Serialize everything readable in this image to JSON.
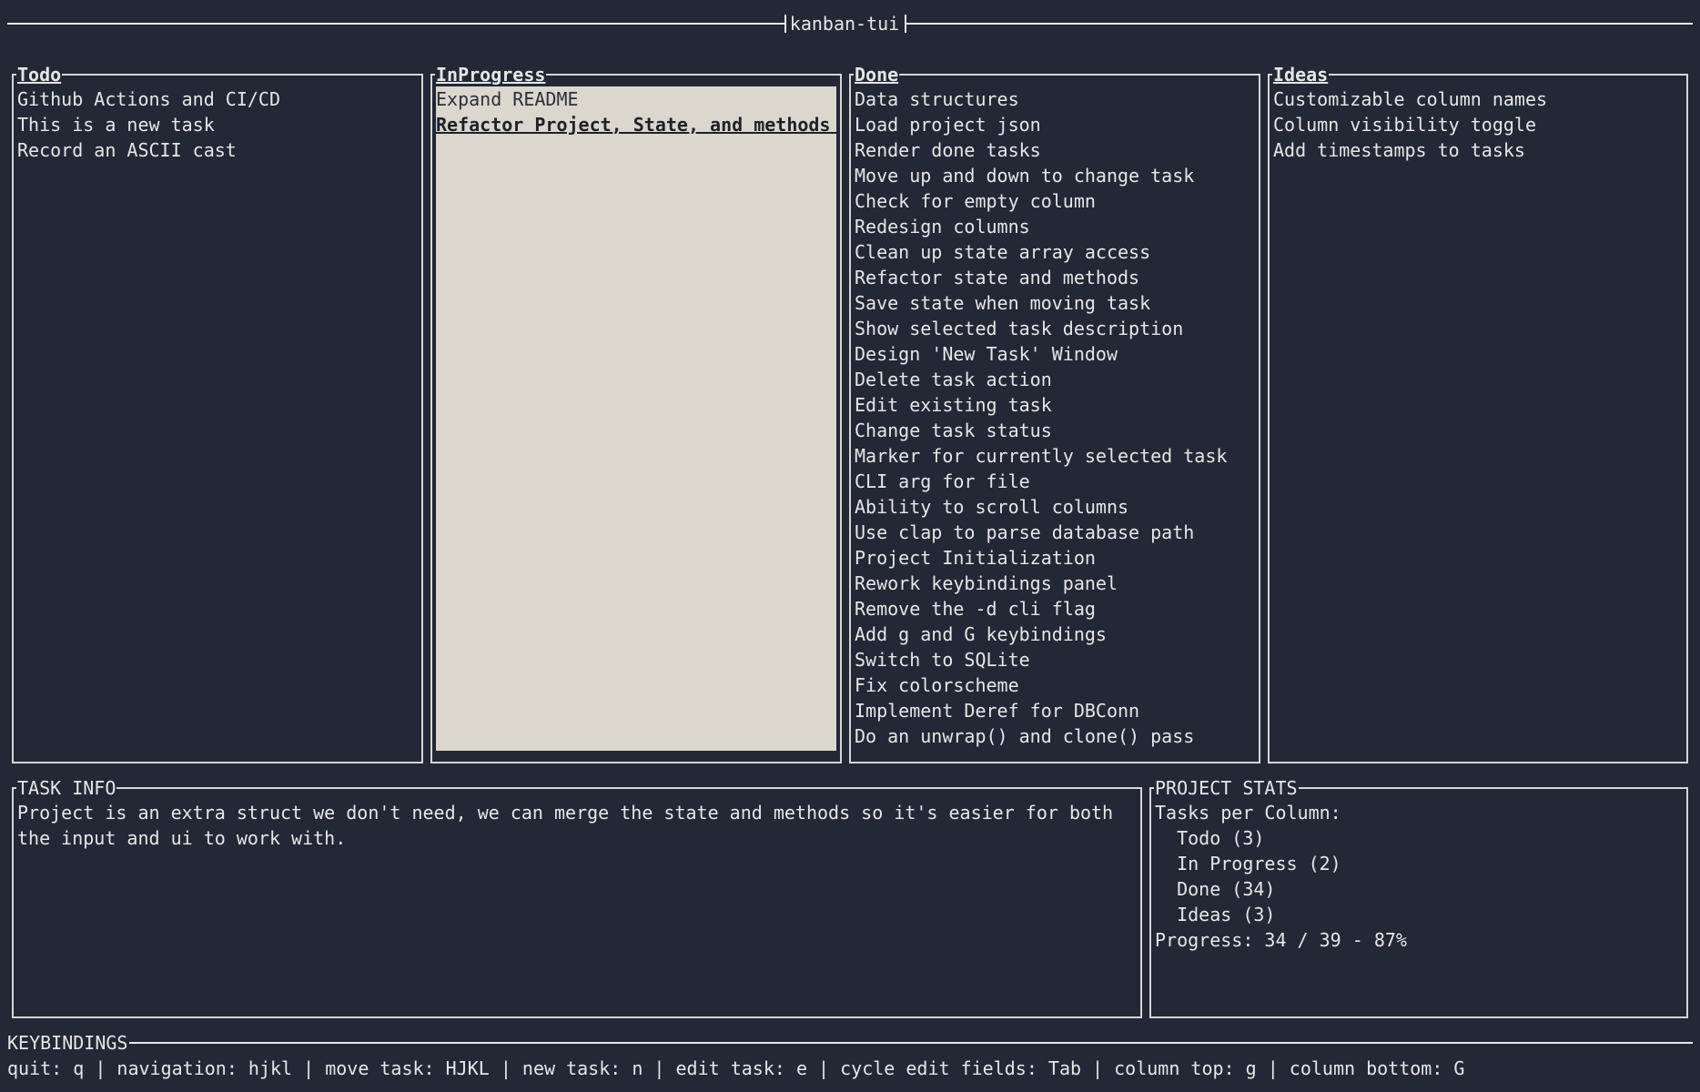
{
  "window": {
    "title": "kanban-tui"
  },
  "columns": [
    {
      "id": "todo",
      "name": "Todo",
      "tasks": [
        "Github Actions and CI/CD",
        "This is a new task",
        "Record an ASCII cast"
      ]
    },
    {
      "id": "inprogress",
      "name": "InProgress",
      "tasks": [
        "Expand README",
        "Refactor Project, State, and methods"
      ],
      "selected_index": 1,
      "selected_marker": "★"
    },
    {
      "id": "done",
      "name": "Done",
      "tasks": [
        "Data structures",
        "Load project json",
        "Render done tasks",
        "Move up and down to change task",
        "Check for empty column",
        "Redesign columns",
        "Clean up state array access",
        "Refactor state and methods",
        "Save state when moving task",
        "Show selected task description",
        "Design 'New Task' Window",
        "Delete task action",
        "Edit existing task",
        "Change task status",
        "Marker for currently selected task",
        "CLI arg for file",
        "Ability to scroll columns",
        "Use clap to parse database path",
        "Project Initialization",
        "Rework keybindings panel",
        "Remove the -d cli flag",
        "Add g and G keybindings",
        "Switch to SQLite",
        "Fix colorscheme",
        "Implement Deref for DBConn",
        "Do an unwrap() and clone() pass"
      ]
    },
    {
      "id": "ideas",
      "name": "Ideas",
      "tasks": [
        "Customizable column names",
        "Column visibility toggle",
        "Add timestamps to tasks"
      ]
    }
  ],
  "task_info": {
    "title": "TASK INFO",
    "description": "Project is an extra struct we don't need, we can merge the state and methods so it's easier for both the input and ui to work with."
  },
  "project_stats": {
    "title": "PROJECT STATS",
    "heading": "Tasks per Column:",
    "lines": [
      "  Todo (3)",
      "  In Progress (2)",
      "  Done (34)",
      "  Ideas (3)"
    ],
    "progress": "Progress: 34 / 39 - 87%"
  },
  "keybindings": {
    "title": "KEYBINDINGS",
    "text": "quit: q | navigation: hjkl | move task: HJKL | new task: n | edit task: e | cycle edit fields: Tab | column top: g | column bottom: G"
  },
  "colors": {
    "background": "#222835",
    "foreground": "#e6e6e6",
    "selected_column_bg": "#dad7ce",
    "selected_column_fg": "#2c2f38",
    "star": "#e8b81c"
  }
}
